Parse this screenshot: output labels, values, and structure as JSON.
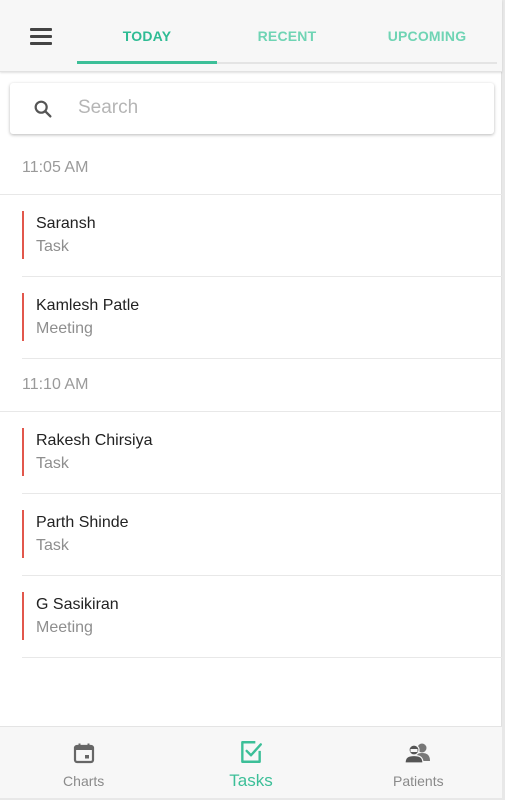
{
  "header": {
    "menu_icon": "hamburger-menu-icon",
    "tabs": [
      {
        "label": "TODAY",
        "active": true
      },
      {
        "label": "RECENT",
        "active": false
      },
      {
        "label": "UPCOMING",
        "active": false
      }
    ]
  },
  "search": {
    "icon": "search-icon",
    "placeholder": "Search",
    "value": ""
  },
  "groups": [
    {
      "time": "11:05 AM",
      "items": [
        {
          "name": "Saransh",
          "type": "Task"
        },
        {
          "name": "Kamlesh Patle",
          "type": "Meeting"
        }
      ]
    },
    {
      "time": "11:10 AM",
      "items": [
        {
          "name": "Rakesh Chirsiya",
          "type": "Task"
        },
        {
          "name": "Parth Shinde",
          "type": "Task"
        },
        {
          "name": "G Sasikiran",
          "type": "Meeting"
        }
      ]
    }
  ],
  "bottom_nav": [
    {
      "label": "Charts",
      "icon": "calendar-icon",
      "active": false
    },
    {
      "label": "Tasks",
      "icon": "checkbox-icon",
      "active": true
    },
    {
      "label": "Patients",
      "icon": "patients-icon",
      "active": false
    }
  ],
  "colors": {
    "accent": "#3cbf98",
    "item_marker": "#e2574c"
  }
}
